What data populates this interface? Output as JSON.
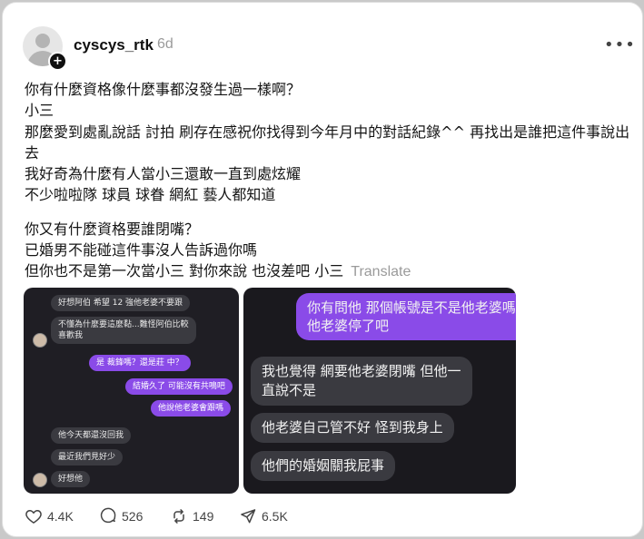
{
  "post": {
    "username": "cyscys_rtk",
    "time_ago": "6d",
    "more_icon": "ellipsis-icon",
    "lines_block1": [
      "你有什麼資格像什麼事都沒發生過一樣啊？",
      "小三",
      "那麼愛到處亂說話 討拍 刷存在感祝你找得到今年月中的對話紀錄^^ 再找出是誰把這件事說出去",
      "我好奇為什麼有人當小三還敢一直到處炫耀",
      "不少啦啦隊 球員 球眷 網紅 藝人都知道"
    ],
    "lines_block2": [
      "你又有什麼資格要誰閉嘴？",
      "已婚男不能碰這件事沒人告訴過你嗎",
      "但你也不是第一次當小三 對你來說 也沒差吧 小三"
    ],
    "translate_label": "Translate"
  },
  "screenshot1": {
    "msg1": "好想阿伯 希望 12 強他老婆不要跟",
    "msg2a": "不懂為什麼要這麼黏...難怪阿伯比較",
    "msg2b": "喜歡我",
    "msg3": "是    裁鋒嗎？還是莊      中？",
    "msg4": "結婚久了 可能沒有共鳴吧",
    "msg5": "他說他老婆會跟嗎",
    "msg6": "他今天都還沒回我",
    "msg7": "最近我們見好少",
    "msg8": "好想他"
  },
  "screenshot2": {
    "msg1a": "你有問他 那個帳號是不是他老婆嗎",
    "msg1b": "他老婆停了吧",
    "msg2a": "我也覺得      網要他老婆閉嘴 但他一",
    "msg2b": "直說不是",
    "msg3": "他老婆自己管不好 怪到我身上",
    "msg4": "他們的婚姻關我屁事"
  },
  "actions": {
    "likes": "4.4K",
    "comments": "526",
    "reposts": "149",
    "shares": "6.5K"
  }
}
